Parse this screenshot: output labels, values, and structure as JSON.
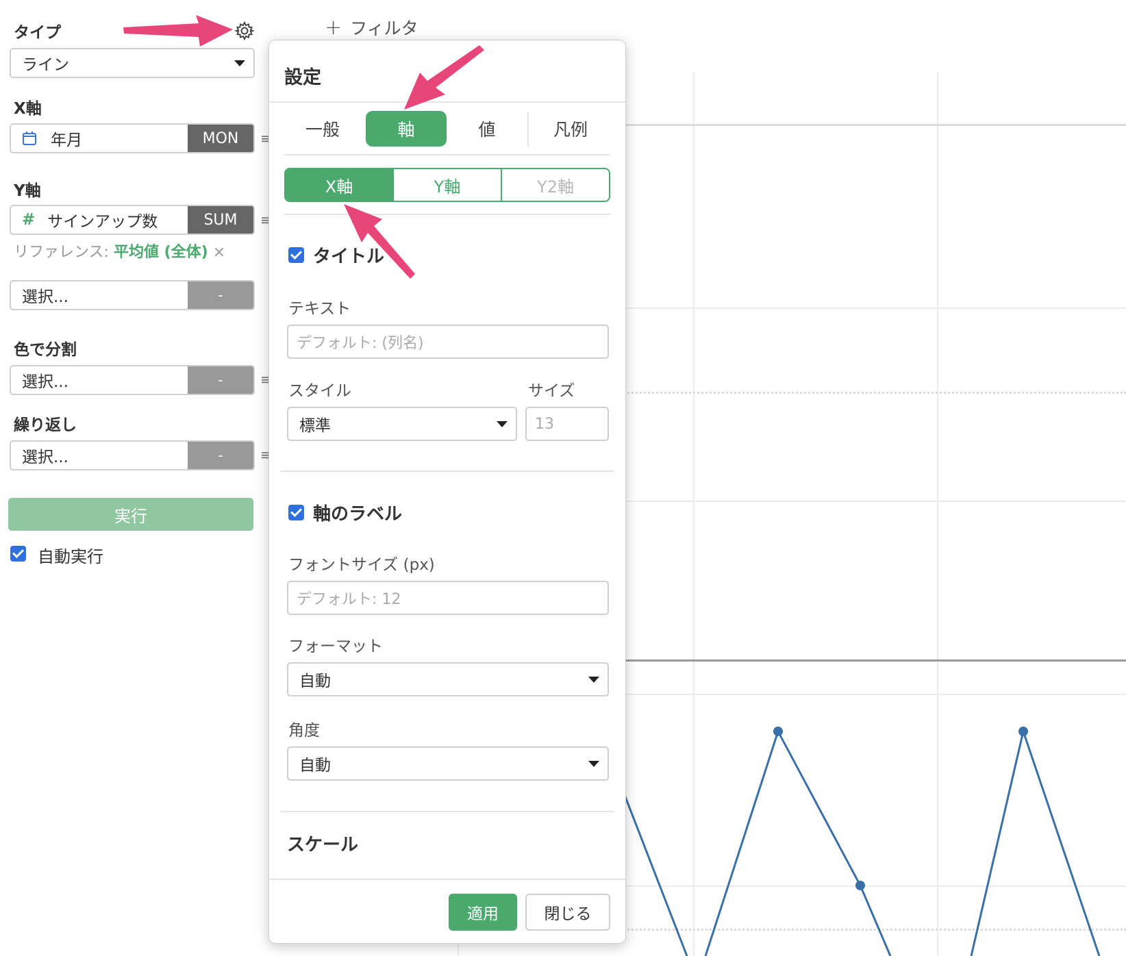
{
  "sidebar": {
    "type_label": "タイプ",
    "type_value": "ライン",
    "x_axis_label": "X軸",
    "x_field": {
      "name": "年月",
      "agg": "MON"
    },
    "y_axis_label": "Y軸",
    "y_field": {
      "name": "サインアップ数",
      "agg": "SUM"
    },
    "reference_prefix": "リファレンス: ",
    "reference_value": "平均値 (全体)",
    "reference_remove": "×",
    "y2_field": {
      "name": "選択...",
      "agg": "-"
    },
    "color_split_label": "色で分割",
    "color_field": {
      "name": "選択...",
      "agg": "-"
    },
    "repeat_label": "繰り返し",
    "repeat_field": {
      "name": "選択...",
      "agg": "-"
    },
    "run_button": "実行",
    "auto_run_label": "自動実行",
    "auto_run_checked": true,
    "settings_icon": "gear-icon"
  },
  "toolbar": {
    "add_filter": "フィルタ",
    "add_filter_icon": "plus-icon"
  },
  "settings_modal": {
    "title": "設定",
    "tabs": [
      "一般",
      "軸",
      "値",
      "凡例"
    ],
    "active_tab": "軸",
    "axis_tabs": [
      "X軸",
      "Y軸",
      "Y2軸"
    ],
    "active_axis_tab": "X軸",
    "title_section": {
      "label": "タイトル",
      "checked": true,
      "text_label": "テキスト",
      "text_placeholder": "デフォルト: (列名)",
      "style_label": "スタイル",
      "style_value": "標準",
      "size_label": "サイズ",
      "size_placeholder": "13"
    },
    "axis_label_section": {
      "label": "軸のラベル",
      "checked": true,
      "font_size_label": "フォントサイズ (px)",
      "font_size_placeholder": "デフォルト: 12",
      "format_label": "フォーマット",
      "format_value": "自動",
      "angle_label": "角度",
      "angle_value": "自動"
    },
    "scale_heading": "スケール",
    "apply_button": "適用",
    "close_button": "閉じる"
  },
  "colors": {
    "accent_green": "#4aa96c",
    "line_blue": "#3a6fa8",
    "annotation_arrow": "#e8457a",
    "checkbox_blue": "#2f6fe0"
  }
}
